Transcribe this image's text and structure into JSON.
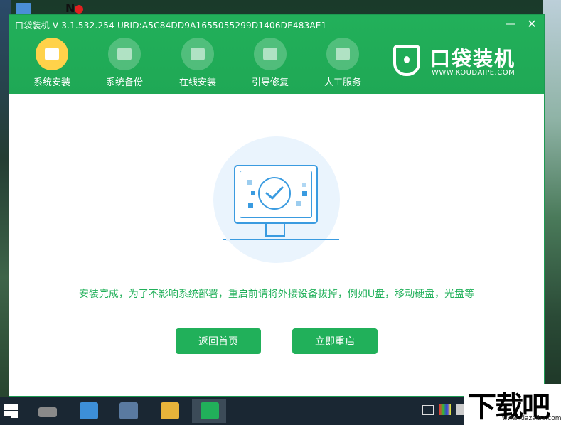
{
  "window": {
    "title": "口袋装机 V 3.1.532.254 URID:A5C84DD9A1655055299D1406DE483AE1",
    "minimize": "—",
    "close": "✕"
  },
  "nav": {
    "items": [
      {
        "label": "系统安装",
        "icon": "system-install-icon",
        "active": true
      },
      {
        "label": "系统备份",
        "icon": "system-backup-icon",
        "active": false
      },
      {
        "label": "在线安装",
        "icon": "online-install-icon",
        "active": false
      },
      {
        "label": "引导修复",
        "icon": "boot-repair-icon",
        "active": false
      },
      {
        "label": "人工服务",
        "icon": "support-chat-icon",
        "active": false
      }
    ]
  },
  "brand": {
    "name": "口袋装机",
    "url": "WWW.KOUDAIPE.COM"
  },
  "main": {
    "message": "安装完成，为了不影响系统部署，重启前请将外接设备拔掉，例如U盘，移动硬盘，光盘等",
    "home_button": "返回首页",
    "restart_button": "立即重启"
  },
  "watermark": {
    "text": "下载吧",
    "url": "www.xiazaiba.com"
  },
  "colors": {
    "accent": "#21b05a",
    "illustration": "#3a9be0",
    "active_nav": "#ffd24a"
  }
}
